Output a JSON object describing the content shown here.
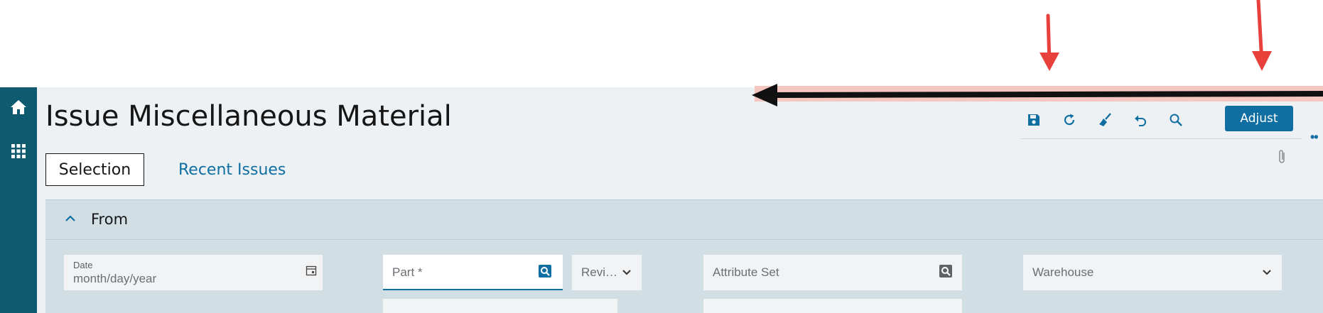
{
  "page": {
    "title": "Issue Miscellaneous Material"
  },
  "rail": {
    "icons": [
      "home-icon",
      "apps-grid-icon"
    ]
  },
  "toolbar": {
    "icons": [
      "save-icon",
      "refresh-icon",
      "clear-icon",
      "undo-icon",
      "search-icon"
    ],
    "adjust_label": "Adjust"
  },
  "tabs": [
    {
      "label": "Selection",
      "selected": true
    },
    {
      "label": "Recent Issues",
      "selected": false
    }
  ],
  "panel": {
    "title": "From",
    "fields": {
      "date_label": "Date",
      "date_placeholder": "month/day/year",
      "part_placeholder": "Part *",
      "revision_placeholder": "Revi…",
      "attribute_set_placeholder": "Attribute Set",
      "warehouse_placeholder": "Warehouse"
    }
  },
  "colors": {
    "rail": "#0e5a6e",
    "accent": "#0f6fa3",
    "panel": "#d1dfe4",
    "annotation_red": "#e8413c"
  }
}
